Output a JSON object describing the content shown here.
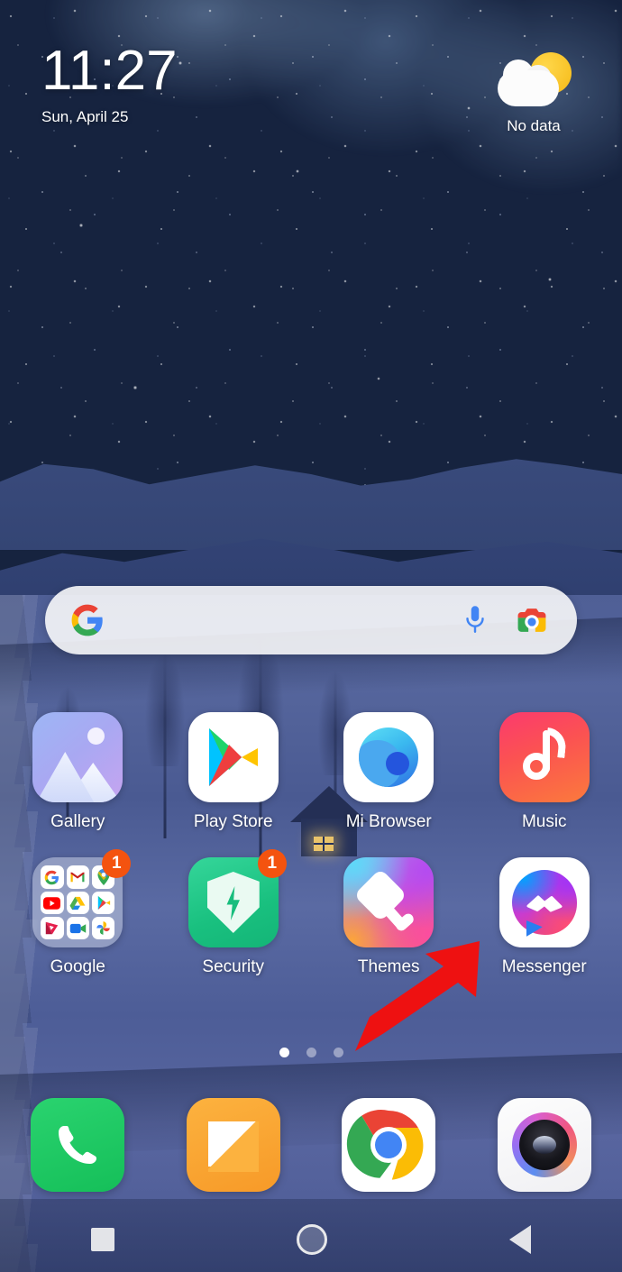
{
  "device": {
    "platform": "android",
    "launcher": "MIUI Home"
  },
  "status": {
    "visible_icons": []
  },
  "clock_widget": {
    "time": "11:27",
    "date": "Sun, April 25"
  },
  "weather_widget": {
    "icon": "sun-behind-cloud-icon",
    "text": "No data"
  },
  "search": {
    "google_logo": "google-g-icon",
    "placeholder": "",
    "value": "",
    "mic_icon": "microphone-icon",
    "lens_icon": "google-lens-camera-icon"
  },
  "apps": {
    "row1": [
      {
        "label": "Gallery",
        "icon": "gallery-icon",
        "badge": null
      },
      {
        "label": "Play Store",
        "icon": "play-store-icon",
        "badge": null
      },
      {
        "label": "Mi Browser",
        "icon": "mi-browser-icon",
        "badge": null
      },
      {
        "label": "Music",
        "icon": "music-icon",
        "badge": null
      }
    ],
    "row2": [
      {
        "label": "Google",
        "icon": "google-folder-icon",
        "badge": "1"
      },
      {
        "label": "Security",
        "icon": "security-shield-icon",
        "badge": "1"
      },
      {
        "label": "Themes",
        "icon": "themes-paint-roller-icon",
        "badge": null
      },
      {
        "label": "Messenger",
        "icon": "messenger-icon",
        "badge": null
      }
    ]
  },
  "google_folder_contents": [
    "google-search-icon",
    "gmail-icon",
    "maps-icon",
    "youtube-icon",
    "drive-icon",
    "play-store-mini-icon",
    "play-movies-icon",
    "meet-icon",
    "photos-icon"
  ],
  "page_indicator": {
    "total": 3,
    "active_index": 0
  },
  "dock": [
    {
      "label": "Phone",
      "icon": "phone-icon"
    },
    {
      "label": "Messages",
      "icon": "messages-icon"
    },
    {
      "label": "Chrome",
      "icon": "chrome-icon"
    },
    {
      "label": "Camera",
      "icon": "camera-icon"
    }
  ],
  "nav_bar": [
    {
      "name": "recents",
      "icon": "square-icon"
    },
    {
      "name": "home",
      "icon": "circle-icon"
    },
    {
      "name": "back",
      "icon": "triangle-left-icon"
    }
  ],
  "annotation": {
    "type": "arrow",
    "color": "#ee1111",
    "points_to": "Messenger",
    "direction": "up-right"
  },
  "colors": {
    "badge": "#f4530f",
    "annotation_red": "#ee1111",
    "label_text": "#ffffff",
    "search_bar_bg": "#fcfcfc",
    "sky_top": "#16243f",
    "sky_bottom": "#5265a0",
    "field": "#4f5f96"
  }
}
